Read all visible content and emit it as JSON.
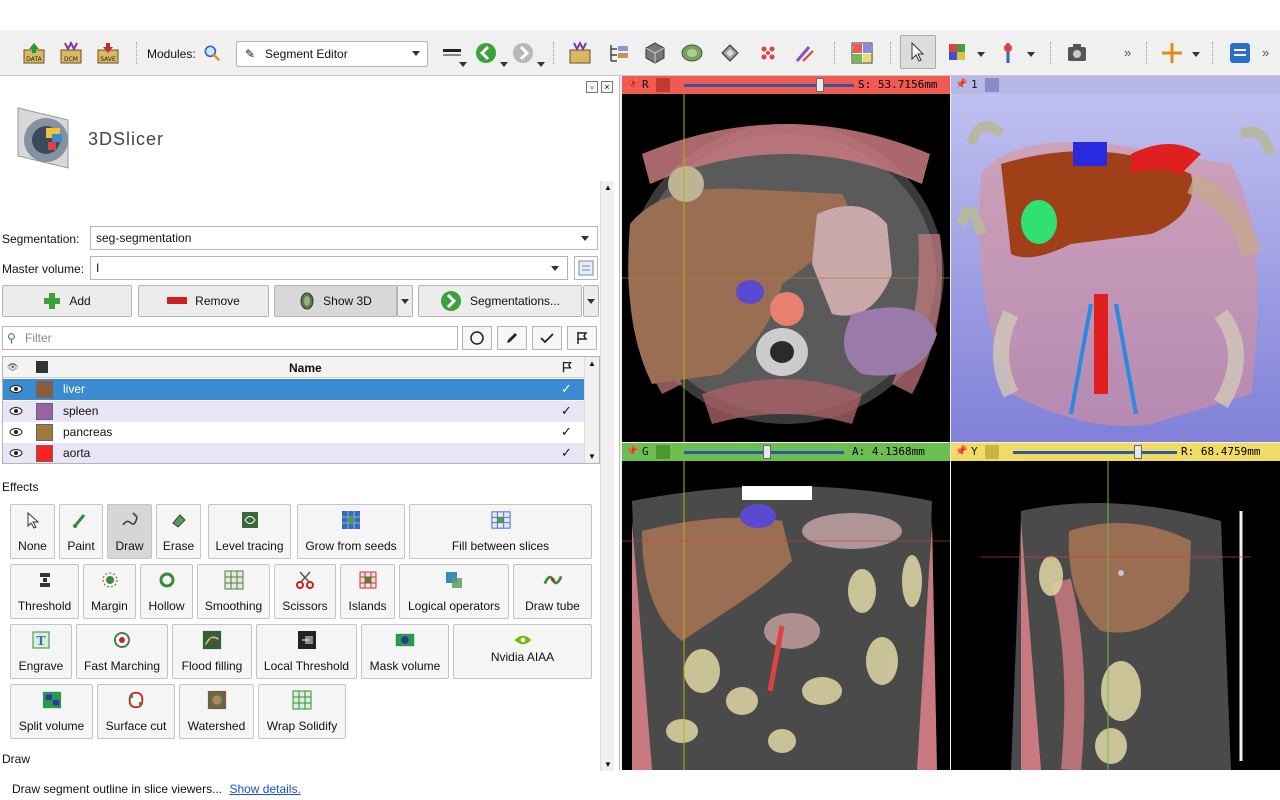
{
  "toolbar": {
    "modules_label": "Modules:",
    "module_selected": "Segment Editor",
    "icons": {
      "data": "DATA",
      "dcm": "DCM",
      "save": "SAVE"
    },
    "overflow": "»"
  },
  "left_panel": {
    "logo_text": "3DSlicer",
    "segmentation_label": "Segmentation:",
    "segmentation_value": "seg-segmentation",
    "master_volume_label": "Master volume:",
    "master_volume_value": "I",
    "add_label": "Add",
    "remove_label": "Remove",
    "show3d_label": "Show 3D",
    "segmentations_label": "Segmentations...",
    "filter_placeholder": "Filter",
    "table_header_name": "Name",
    "segments": [
      {
        "name": "liver",
        "color": "#8c5a3c",
        "visible": true,
        "selected": true
      },
      {
        "name": "spleen",
        "color": "#9664a0",
        "visible": true,
        "selected": false
      },
      {
        "name": "pancreas",
        "color": "#a07840",
        "visible": true,
        "selected": false
      },
      {
        "name": "aorta",
        "color": "#ff2020",
        "visible": true,
        "selected": false
      }
    ],
    "effects_label": "Effects",
    "effects": [
      "None",
      "Paint",
      "Draw",
      "Erase",
      "Level tracing",
      "Grow from seeds",
      "Fill between slices",
      "Threshold",
      "Margin",
      "Hollow",
      "Smoothing",
      "Scissors",
      "Islands",
      "Logical operators",
      "Draw tube",
      "Engrave",
      "Fast Marching",
      "Flood filling",
      "Local Threshold",
      "Mask volume",
      "Nvidia AIAA",
      "Split volume",
      "Surface cut",
      "Watershed",
      "Wrap Solidify"
    ],
    "draw_section_label": "Draw",
    "draw_description": "Draw segment outline in slice viewers...",
    "show_details_link": "Show details."
  },
  "viewers": {
    "red": {
      "letter": "R",
      "readout": "S: 53.7156mm",
      "color": "#f05a50"
    },
    "threed": {
      "letter": "1",
      "color": "#8a8ad8"
    },
    "green": {
      "letter": "G",
      "readout": "A: 4.1368mm",
      "color": "#6cbe50"
    },
    "yellow": {
      "letter": "Y",
      "readout": "R: 68.4759mm",
      "color": "#f0dc64"
    }
  }
}
